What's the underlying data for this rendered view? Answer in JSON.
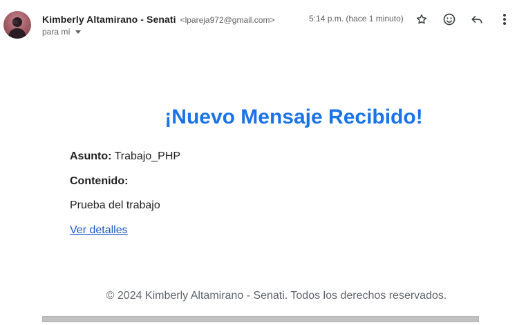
{
  "sender": {
    "name": "Kimberly Altamirano - Senati",
    "email": "<lpareja972@gmail.com>",
    "recipient_label": "para mí",
    "timestamp": "5:14 p.m. (hace 1 minuto)"
  },
  "toolbar": {
    "star_icon": "star-icon",
    "emoji_icon": "emoji-reaction-icon",
    "reply_icon": "reply-icon",
    "more_icon": "more-vertical-icon"
  },
  "message": {
    "title": "¡Nuevo Mensaje Recibido!",
    "subject_label": "Asunto:",
    "subject_value": "Trabajo_PHP",
    "content_label": "Contenido:",
    "content_value": "Prueba del trabajo",
    "details_link": "Ver detalles",
    "footer": "© 2024 Kimberly Altamirano - Senati. Todos los derechos reservados."
  },
  "colors": {
    "title": "#1a73e8",
    "link": "#1a56c4",
    "footer_text": "#5f6368"
  }
}
